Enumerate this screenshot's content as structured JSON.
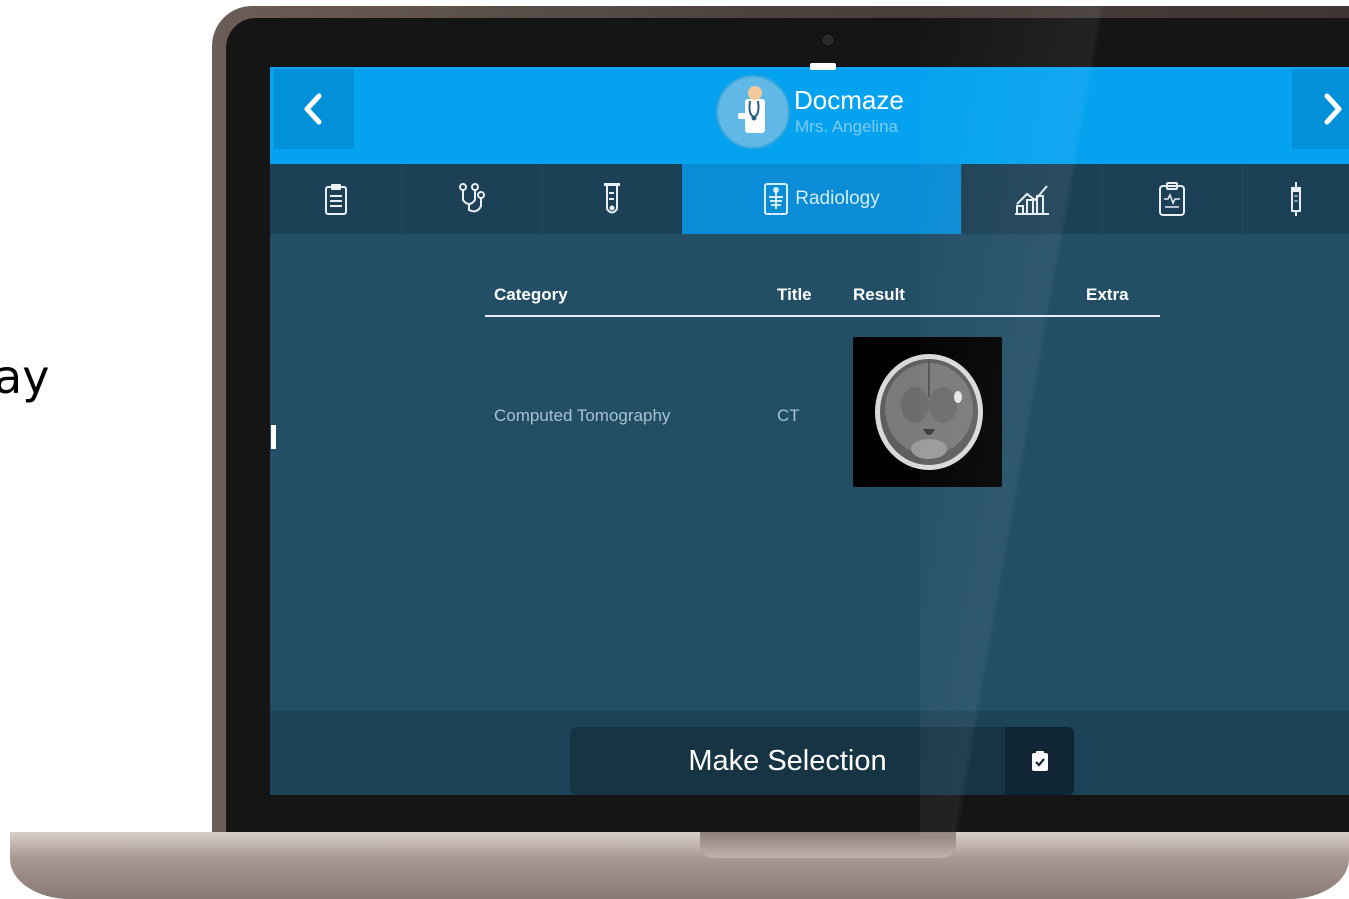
{
  "side_text": "ay",
  "header": {
    "title": "Docmaze",
    "subtitle": "Mrs. Angelina",
    "prev_icon": "chevron-left-icon",
    "next_icon": "chevron-right-icon"
  },
  "tabs": [
    {
      "icon": "clipboard-icon",
      "label": ""
    },
    {
      "icon": "stethoscope-icon",
      "label": ""
    },
    {
      "icon": "test-tube-icon",
      "label": ""
    },
    {
      "icon": "x-ray-icon",
      "label": "Radiology",
      "active": true
    },
    {
      "icon": "chart-icon",
      "label": ""
    },
    {
      "icon": "report-icon",
      "label": ""
    },
    {
      "icon": "syringe-icon",
      "label": ""
    }
  ],
  "table": {
    "headers": [
      "Category",
      "Title",
      "Result",
      "Extra"
    ],
    "rows": [
      {
        "category": "Computed Tomography",
        "title": "CT",
        "result": "ct-scan-image",
        "extra": ""
      }
    ]
  },
  "footer": {
    "button_label": "Make Selection",
    "button_icon": "clipboard-check-icon"
  },
  "colors": {
    "topbar": "#04a2ef",
    "tab_active": "#0a8cd6",
    "screen_bg": "#224e66"
  }
}
